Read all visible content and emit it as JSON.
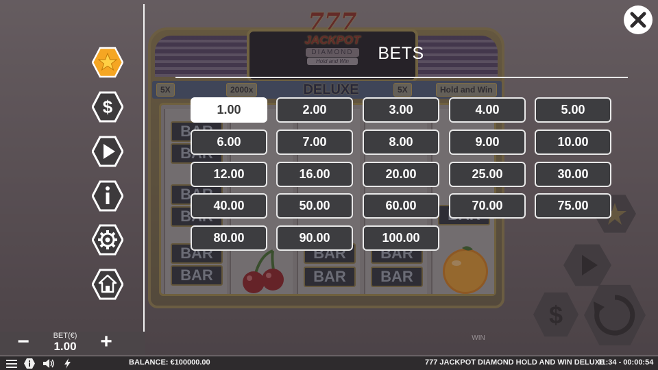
{
  "game": {
    "title": "777 JACKPOT DIAMOND HOLD AND WIN DELUXE",
    "logo": {
      "line1": "777",
      "line2": "JACKPOT",
      "line3": "DIAMOND",
      "line4": "Hold and Win",
      "line5": "DELUXE"
    },
    "info_strip": [
      "5X",
      "2000x",
      "5X",
      "Hold and Win"
    ],
    "reel_symbol": "BAR",
    "win_label": "WIN"
  },
  "menu": {
    "items": [
      {
        "name": "favorites",
        "icon": "star-icon"
      },
      {
        "name": "bets",
        "icon": "dollar-icon"
      },
      {
        "name": "autoplay",
        "icon": "play-icon"
      },
      {
        "name": "info",
        "icon": "info-icon"
      },
      {
        "name": "settings",
        "icon": "gear-icon"
      },
      {
        "name": "home",
        "icon": "home-icon"
      }
    ]
  },
  "bets_panel": {
    "title": "BETS",
    "selected": "1.00",
    "options": [
      "1.00",
      "2.00",
      "3.00",
      "4.00",
      "5.00",
      "6.00",
      "7.00",
      "8.00",
      "9.00",
      "10.00",
      "12.00",
      "16.00",
      "20.00",
      "25.00",
      "30.00",
      "40.00",
      "50.00",
      "60.00",
      "70.00",
      "75.00",
      "80.00",
      "90.00",
      "100.00"
    ]
  },
  "bet_control": {
    "label": "BET(€)",
    "value": "1.00",
    "minus": "−",
    "plus": "+"
  },
  "status_bar": {
    "balance": "BALANCE: €100000.00",
    "game_title": "777 JACKPOT DIAMOND HOLD AND WIN DELUXE",
    "time": "11:34 - 00:00:54"
  },
  "colors": {
    "accent_star": "#f5a623",
    "panel_button": "#3d3d40",
    "selected_button": "#ffffff"
  }
}
